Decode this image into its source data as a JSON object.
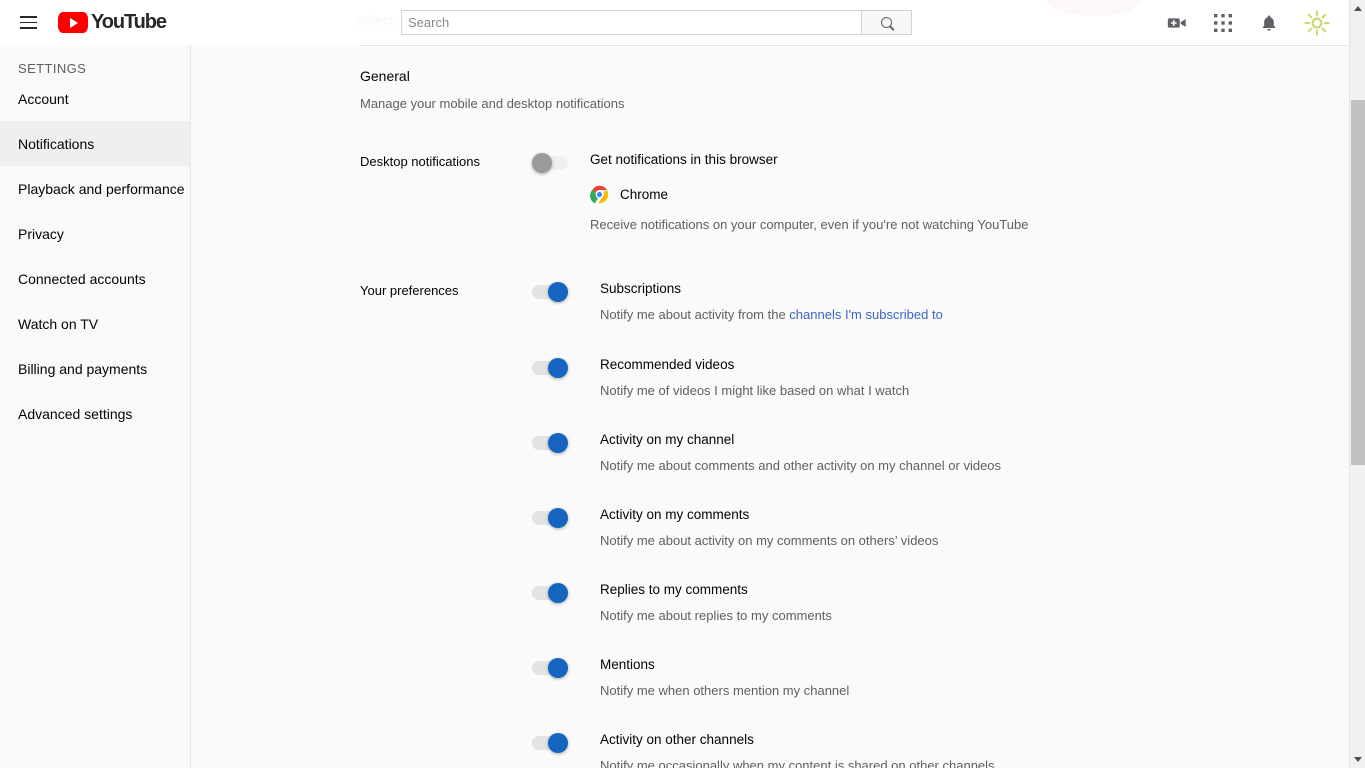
{
  "header": {
    "menu_icon": "hamburger-menu-icon",
    "logo_text": "YouTube",
    "ghost_text": "Select",
    "search": {
      "placeholder": "Search",
      "value": ""
    },
    "search_button_icon": "search-icon",
    "icons": [
      {
        "name": "create-video-icon",
        "label": "Create"
      },
      {
        "name": "apps-grid-icon",
        "label": "YouTube apps"
      },
      {
        "name": "notifications-bell-icon",
        "label": "Notifications"
      }
    ],
    "avatar_icon": "sun-avatar-icon",
    "avatar_color": "#c8d96f"
  },
  "sidebar": {
    "title": "SETTINGS",
    "active": "Notifications",
    "items": [
      {
        "label": "Account"
      },
      {
        "label": "Notifications"
      },
      {
        "label": "Playback and performance"
      },
      {
        "label": "Privacy"
      },
      {
        "label": "Connected accounts"
      },
      {
        "label": "Watch on TV"
      },
      {
        "label": "Billing and payments"
      },
      {
        "label": "Advanced settings"
      }
    ]
  },
  "main": {
    "section_title": "General",
    "section_subtitle": "Manage your mobile and desktop notifications",
    "desktop": {
      "label": "Desktop notifications",
      "toggle_label": "Get notifications in this browser",
      "toggle_state": "off",
      "browser_icon": "chrome-icon",
      "browser_name": "Chrome",
      "description": "Receive notifications on your computer, even if you're not watching YouTube"
    },
    "preferences": {
      "label": "Your preferences",
      "items": [
        {
          "label": "Subscriptions",
          "state": "on",
          "desc_before": "Notify me about activity from the ",
          "desc_link": "channels I'm subscribed to",
          "desc_after": ""
        },
        {
          "label": "Recommended videos",
          "state": "on",
          "desc_before": "Notify me of videos I might like based on what I watch",
          "desc_link": "",
          "desc_after": ""
        },
        {
          "label": "Activity on my channel",
          "state": "on",
          "desc_before": "Notify me about comments and other activity on my channel or videos",
          "desc_link": "",
          "desc_after": ""
        },
        {
          "label": "Activity on my comments",
          "state": "on",
          "desc_before": "Notify me about activity on my comments on others’ videos",
          "desc_link": "",
          "desc_after": ""
        },
        {
          "label": "Replies to my comments",
          "state": "on",
          "desc_before": "Notify me about replies to my comments",
          "desc_link": "",
          "desc_after": ""
        },
        {
          "label": "Mentions",
          "state": "on",
          "desc_before": "Notify me when others mention my channel",
          "desc_link": "",
          "desc_after": ""
        },
        {
          "label": "Activity on other channels",
          "state": "on",
          "desc_before": "Notify me occasionally when my content is shared on other channels",
          "desc_link": "",
          "desc_after": ""
        }
      ]
    }
  },
  "colors": {
    "accent_blue": "#1565c0",
    "link_blue": "#3a66c2",
    "brand_red": "#ff0000",
    "sidebar_bg": "#f9f9f9",
    "content_bg": "#fafafa"
  }
}
